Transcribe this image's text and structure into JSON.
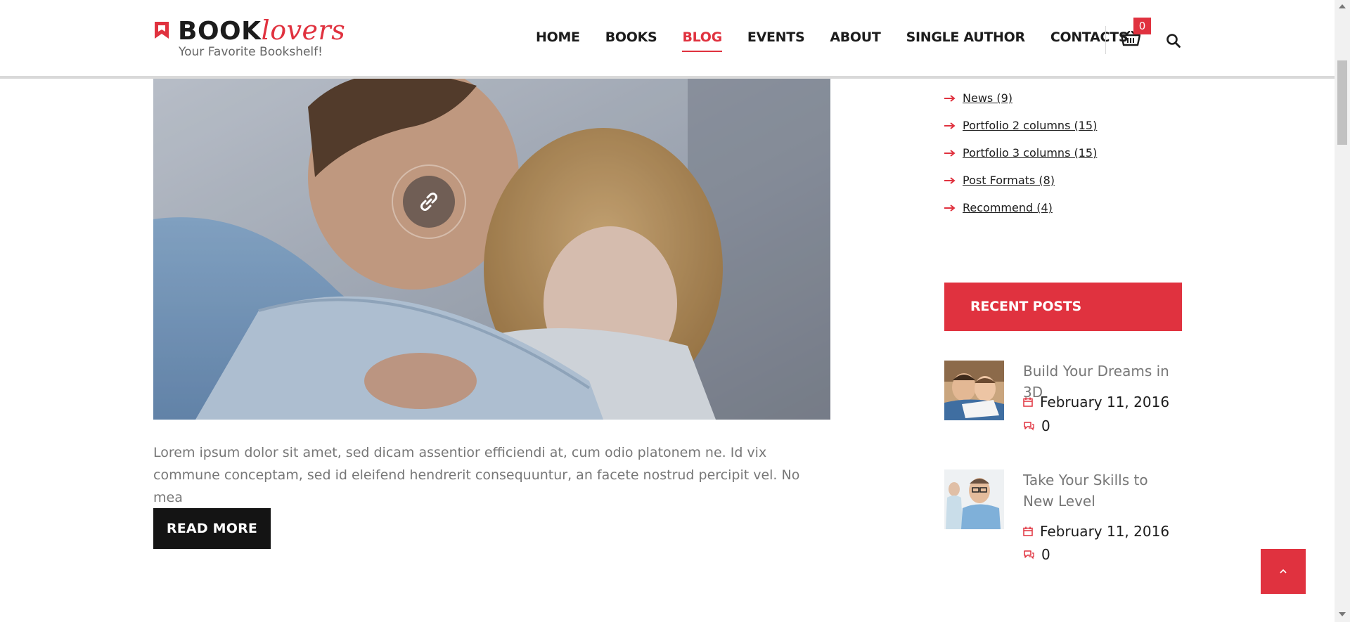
{
  "brand": {
    "name_bold": "BOOK",
    "name_script": "lovers",
    "tagline": "Your Favorite Bookshelf!",
    "accent_color": "#e0323f"
  },
  "nav": {
    "items": [
      {
        "label": "HOME",
        "active": false
      },
      {
        "label": "BOOKS",
        "active": false
      },
      {
        "label": "BLOG",
        "active": true
      },
      {
        "label": "EVENTS",
        "active": false
      },
      {
        "label": "ABOUT",
        "active": false
      },
      {
        "label": "SINGLE AUTHOR",
        "active": false
      },
      {
        "label": "CONTACTS",
        "active": false
      }
    ],
    "cart_count": "0",
    "cart_icon": "basket-icon",
    "search_icon": "search-icon"
  },
  "post": {
    "image_icon": "link-icon",
    "excerpt": "Lorem ipsum dolor sit amet, sed dicam assentior efficiendi at, cum odio platonem ne. Id vix commune conceptam, sed id eleifend hendrerit consequuntur, an facete nostrud percipit vel. No mea",
    "read_more_label": "READ MORE"
  },
  "sidebar": {
    "categories": [
      {
        "label": "News (9)"
      },
      {
        "label": "Portfolio 2 columns (15)"
      },
      {
        "label": "Portfolio 3 columns (15)"
      },
      {
        "label": "Post Formats (8)"
      },
      {
        "label": "Recommend (4)"
      }
    ],
    "recent_posts_title": "RECENT POSTS",
    "recent_posts": [
      {
        "title": "Build Your Dreams in 3D",
        "date": "February 11, 2016",
        "comments": "0"
      },
      {
        "title": "Take Your Skills to New Level",
        "date": "February 11, 2016",
        "comments": "0"
      }
    ]
  }
}
